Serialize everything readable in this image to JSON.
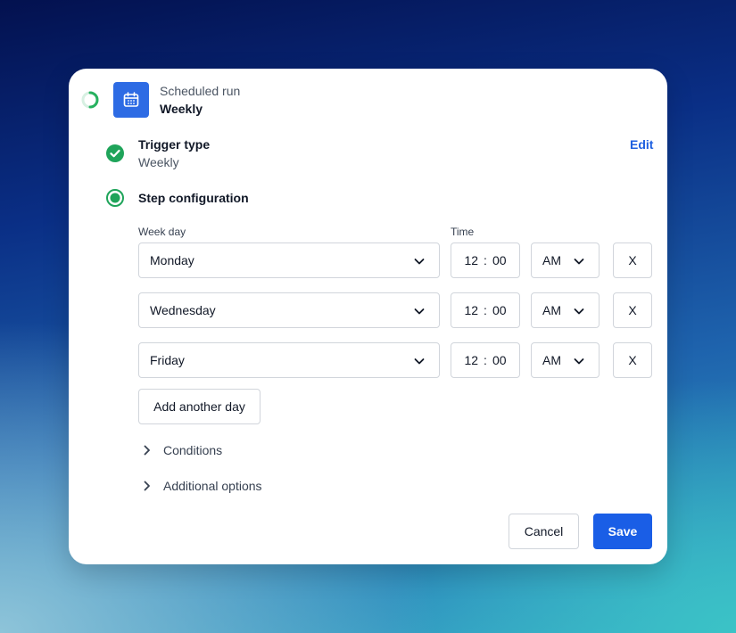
{
  "header": {
    "subtitle": "Scheduled run",
    "title": "Weekly"
  },
  "trigger": {
    "label": "Trigger type",
    "value": "Weekly",
    "edit_label": "Edit"
  },
  "step": {
    "label": "Step configuration"
  },
  "fields": {
    "week_day_label": "Week day",
    "time_label": "Time"
  },
  "rows": [
    {
      "day": "Monday",
      "hour": "12",
      "minute": "00",
      "period": "AM",
      "remove_label": "X"
    },
    {
      "day": "Wednesday",
      "hour": "12",
      "minute": "00",
      "period": "AM",
      "remove_label": "X"
    },
    {
      "day": "Friday",
      "hour": "12",
      "minute": "00",
      "period": "AM",
      "remove_label": "X"
    }
  ],
  "add_day_label": "Add another day",
  "sections": [
    {
      "label": "Conditions"
    },
    {
      "label": "Additional options"
    }
  ],
  "footer": {
    "cancel_label": "Cancel",
    "save_label": "Save"
  },
  "colors": {
    "accent": "#1a5ee6",
    "success": "#1fa45a",
    "icon_tile": "#2d6be4"
  },
  "icons": [
    "spinner-icon",
    "calendar-icon",
    "check-circle-icon",
    "radio-active-icon",
    "chevron-down-icon",
    "chevron-right-icon"
  ]
}
